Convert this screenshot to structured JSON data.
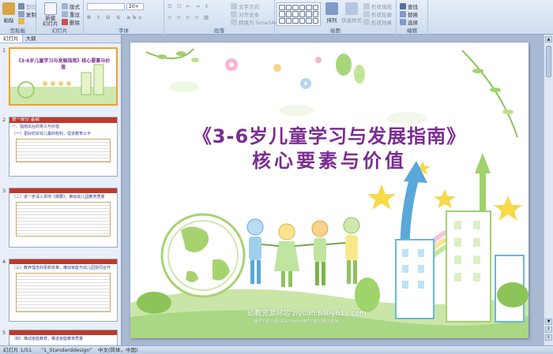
{
  "ribbon": {
    "clipboard": {
      "paste": "粘贴",
      "cut": "剪切",
      "copy": "复制",
      "format_painter": "格式刷",
      "label": "剪贴板"
    },
    "slides": {
      "new_slide": "新建",
      "new_slide2": "幻灯片",
      "layout": "版式",
      "reset": "重设",
      "delete": "删除",
      "label": "幻灯片"
    },
    "font": {
      "size": "20+",
      "label": "字体"
    },
    "paragraph": {
      "text_direction": "文字方向",
      "align_text": "对齐文本",
      "smartart": "转换为 SmartArt",
      "label": "段落"
    },
    "drawing": {
      "arrange": "排列",
      "quick_styles": "快速样式",
      "shape_fill": "形状填充",
      "shape_outline": "形状轮廓",
      "shape_effects": "形状效果",
      "label": "绘图"
    },
    "editing": {
      "find": "查找",
      "replace": "替换",
      "select": "选择",
      "label": "编辑"
    }
  },
  "panel": {
    "tabs": [
      "幻灯片",
      "大纲"
    ],
    "thumbnails": [
      {
        "num": "1",
        "title": "《3-6岁儿童学习与发展指南》核心要素与价值"
      },
      {
        "num": "2",
        "header": "第一部分  基础",
        "line1": "一、指南出台的意义与价值",
        "line2": "（一）更好的实现儿童的权利，促进教育公平"
      },
      {
        "num": "3",
        "header": "",
        "line1": "（二）进一步深入贯彻《纲要》，推动幼儿园教育质量",
        "line2": ""
      },
      {
        "num": "4",
        "header": "",
        "line1": "（三）教养理念的更新变革，推动家庭与幼儿园协同合作",
        "line2": ""
      },
      {
        "num": "5",
        "header": "",
        "line1": "（四）推动家庭教育，推进家庭教育质量",
        "line2": ""
      }
    ]
  },
  "slide": {
    "title_line1": "《3-6岁儿童学习与发展指南》",
    "title_line2": "核心要素与价值",
    "watermark": "幼教资源网站  ziyuan.baby611.com",
    "watermark_sub": "课件下载  儿歌  故事  FLASH课件下载  试卷下载等"
  },
  "status": {
    "slide_pos": "幻灯片 1/51",
    "theme": "\"1_Standarddesign\"",
    "language": "中文(简体，中国)"
  },
  "colors": {
    "title": "#7a2c91",
    "ribbon": "#dfe8f5",
    "selection": "#f0a030"
  }
}
